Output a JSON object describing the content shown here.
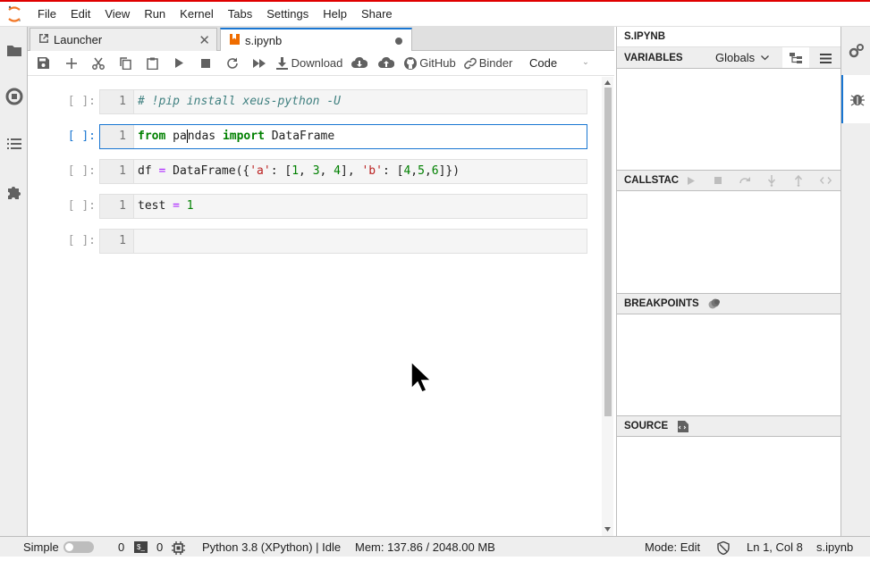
{
  "menu": [
    "File",
    "Edit",
    "View",
    "Run",
    "Kernel",
    "Tabs",
    "Settings",
    "Help",
    "Share"
  ],
  "tabs": {
    "launcher": "Launcher",
    "notebook": "s.ipynb"
  },
  "toolbar": {
    "download": "Download",
    "github": "GitHub",
    "binder": "Binder",
    "cell_type": "Code"
  },
  "cells": [
    {
      "prompt": "[ ]:",
      "line": "1",
      "code": "# !pip install xeus-python -U"
    },
    {
      "prompt": "[ ]:",
      "line": "1",
      "code": "from pandas import DataFrame"
    },
    {
      "prompt": "[ ]:",
      "line": "1",
      "code": "df = DataFrame({'a': [1, 3, 4], 'b': [4,5,6]})"
    },
    {
      "prompt": "[ ]:",
      "line": "1",
      "code": "test = 1"
    },
    {
      "prompt": "[ ]:",
      "line": "1",
      "code": ""
    }
  ],
  "debugger": {
    "title": "S.IPYNB",
    "variables": "VARIABLES",
    "scope": "Globals",
    "callstack": "CALLSTAC",
    "breakpoints": "BREAKPOINTS",
    "source": "SOURCE"
  },
  "status": {
    "mode_label": "Simple",
    "terminals": "0",
    "kernels": "0",
    "kernel": "Python 3.8 (XPython) | Idle",
    "mem": "Mem: 137.86 / 2048.00 MB",
    "edit_mode": "Mode: Edit",
    "cursor": "Ln 1, Col 8",
    "file": "s.ipynb"
  },
  "colors": {
    "accent": "#1976d2",
    "topline": "#e00000"
  }
}
